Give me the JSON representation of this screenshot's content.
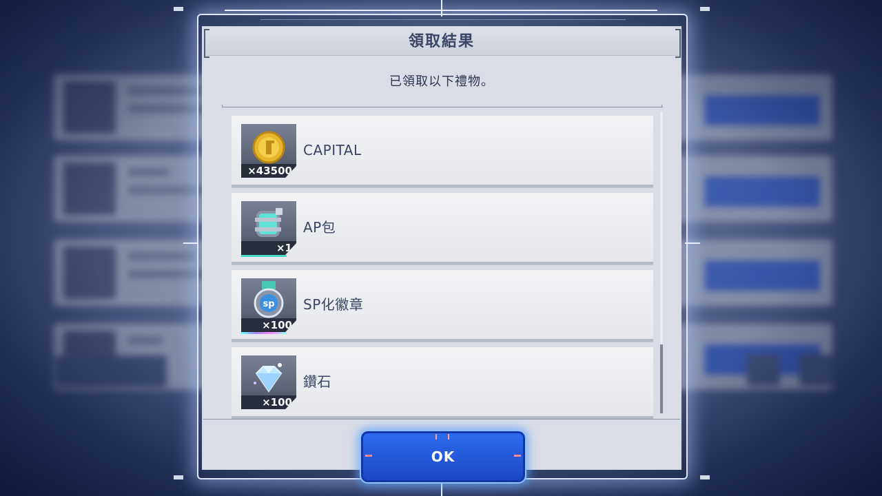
{
  "dialog": {
    "title": "領取結果",
    "subtitle": "已領取以下禮物。",
    "ok_label": "OK"
  },
  "rewards": [
    {
      "name": "CAPITAL",
      "quantity": "×43500",
      "icon": "gold-coin-icon"
    },
    {
      "name": "AP包",
      "quantity": "×1",
      "icon": "ap-pack-icon"
    },
    {
      "name": "SP化徽章",
      "quantity": "×100",
      "icon": "sp-badge-icon"
    },
    {
      "name": "鑽石",
      "quantity": "×100",
      "icon": "diamond-icon"
    }
  ],
  "colors": {
    "title_text": "#3a4566",
    "ok_button": "#2d6df0",
    "frame_glow": "#dfe8ff"
  }
}
